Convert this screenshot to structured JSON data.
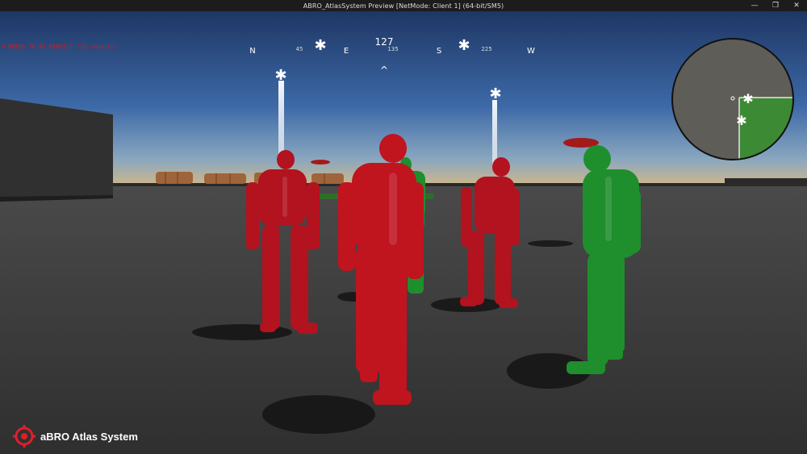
{
  "window": {
    "title": "ABRO_AtlasSystem Preview [NetMode: Client 1]  (64-bit/SM5)",
    "controls": [
      "—",
      "❐",
      "✕"
    ]
  },
  "debug": {
    "message": "0 NEEDS TO BE REBUILT (11 unbuilt)",
    "sub": ""
  },
  "compass": {
    "heading": "127",
    "labels": [
      {
        "text": "N"
      },
      {
        "text": "45"
      },
      {
        "text": "E"
      },
      {
        "text": "135"
      },
      {
        "text": "S"
      },
      {
        "text": "225"
      },
      {
        "text": "W"
      }
    ],
    "caret": "^"
  },
  "markers": {
    "glyph": "✱"
  },
  "minimap": {
    "player_glyph": "✱",
    "territory_color": "#3d8a34",
    "ground_color": "#5f5d57"
  },
  "branding": {
    "text": "aBRO Atlas System",
    "logo_color": "#e01e2b"
  },
  "colors": {
    "red_team": "#b3121f",
    "green_team": "#1f8f2a",
    "sky_top": "#1d3a6b",
    "sky_horizon": "#c7b48a",
    "ground": "#3a3a3a"
  }
}
